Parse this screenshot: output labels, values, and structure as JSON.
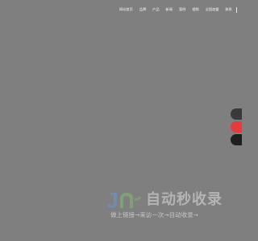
{
  "nav": {
    "items": [
      {
        "label": "网站首页"
      },
      {
        "label": "品牌"
      },
      {
        "label": "产品"
      },
      {
        "label": "新闻"
      },
      {
        "label": "案例"
      },
      {
        "label": "视频"
      },
      {
        "label": "全国加盟"
      },
      {
        "label": "联系"
      }
    ]
  },
  "side_buttons": [
    {
      "name": "side-button-1",
      "color": "#3a3a3a"
    },
    {
      "name": "side-button-2",
      "color": "#e43b3b"
    },
    {
      "name": "side-button-3",
      "color": "#1f1f1f"
    }
  ],
  "watermark": {
    "logo_text": "JR",
    "title": "自动秒收录",
    "subtitle": "做上链接→来访一次→自动收录→"
  },
  "colors": {
    "background": "#7f7f7f",
    "nav_text": "#ffffff",
    "accent_red": "#e43b3b",
    "watermark_blue": "#4a6fb3",
    "watermark_green": "#6aa84f"
  }
}
